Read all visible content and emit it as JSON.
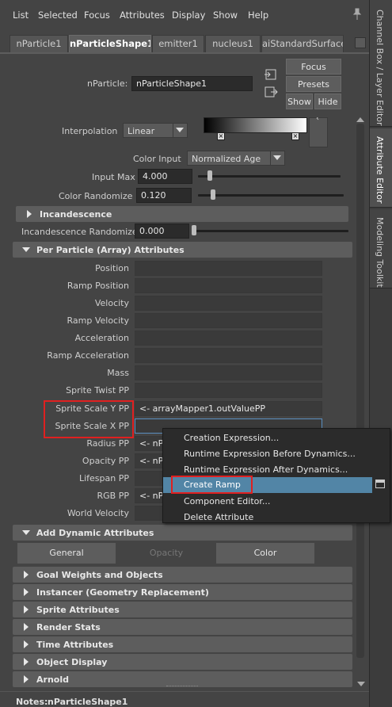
{
  "menu": [
    "List",
    "Selected",
    "Focus",
    "Attributes",
    "Display",
    "Show",
    "Help"
  ],
  "tabs": [
    "nParticle1",
    "nParticleShape1",
    "emitter1",
    "nucleus1",
    "aiStandardSurface"
  ],
  "header": {
    "node_label": "nParticle:",
    "node_value": "nParticleShape1",
    "focus": "Focus",
    "presets": "Presets",
    "show": "Show",
    "hide": "Hide"
  },
  "rightbar": [
    "Channel Box / Layer Editor",
    "Attribute Editor",
    "Modeling Toolkit"
  ],
  "color_section": {
    "interpolation_label": "Interpolation",
    "interpolation_value": "Linear",
    "color_input_label": "Color Input",
    "color_input_value": "Normalized Age",
    "input_max_label": "Input Max",
    "input_max_value": "4.000",
    "color_randomize_label": "Color Randomize",
    "color_randomize_value": "0.120"
  },
  "incandescence": {
    "title": "Incandescence",
    "randomize_label": "Incandescence Randomize",
    "randomize_value": "0.000"
  },
  "per_particle": {
    "title": "Per Particle (Array) Attributes",
    "rows": [
      {
        "label": "Position",
        "value": ""
      },
      {
        "label": "Ramp Position",
        "value": ""
      },
      {
        "label": "Velocity",
        "value": ""
      },
      {
        "label": "Ramp Velocity",
        "value": ""
      },
      {
        "label": "Acceleration",
        "value": ""
      },
      {
        "label": "Ramp Acceleration",
        "value": ""
      },
      {
        "label": "Mass",
        "value": ""
      },
      {
        "label": "Sprite Twist PP",
        "value": ""
      },
      {
        "label": "Sprite Scale Y PP",
        "value": "<- arrayMapper1.outValuePP"
      },
      {
        "label": "Sprite Scale X PP",
        "value": ""
      },
      {
        "label": "Radius PP",
        "value": "<- nP"
      },
      {
        "label": "Opacity PP",
        "value": "<- nP"
      },
      {
        "label": "Lifespan PP",
        "value": ""
      },
      {
        "label": "RGB PP",
        "value": "<- nP"
      },
      {
        "label": "World Velocity",
        "value": ""
      }
    ]
  },
  "dynamic": {
    "title": "Add Dynamic Attributes",
    "buttons": [
      "General",
      "Opacity",
      "Color"
    ]
  },
  "sections": [
    "Goal Weights and Objects",
    "Instancer (Geometry Replacement)",
    "Sprite Attributes",
    "Render Stats",
    "Time Attributes",
    "Object Display",
    "Arnold"
  ],
  "context_menu": {
    "items": [
      "Creation Expression...",
      "Runtime Expression Before Dynamics...",
      "Runtime Expression After Dynamics...",
      "Create Ramp",
      "Component Editor...",
      "Delete Attribute"
    ],
    "highlighted": "Create Ramp"
  },
  "notes": {
    "label": "Notes:",
    "value": "nParticleShape1"
  },
  "colors": {
    "highlight": "#5285a6",
    "annotation": "#e02020"
  }
}
